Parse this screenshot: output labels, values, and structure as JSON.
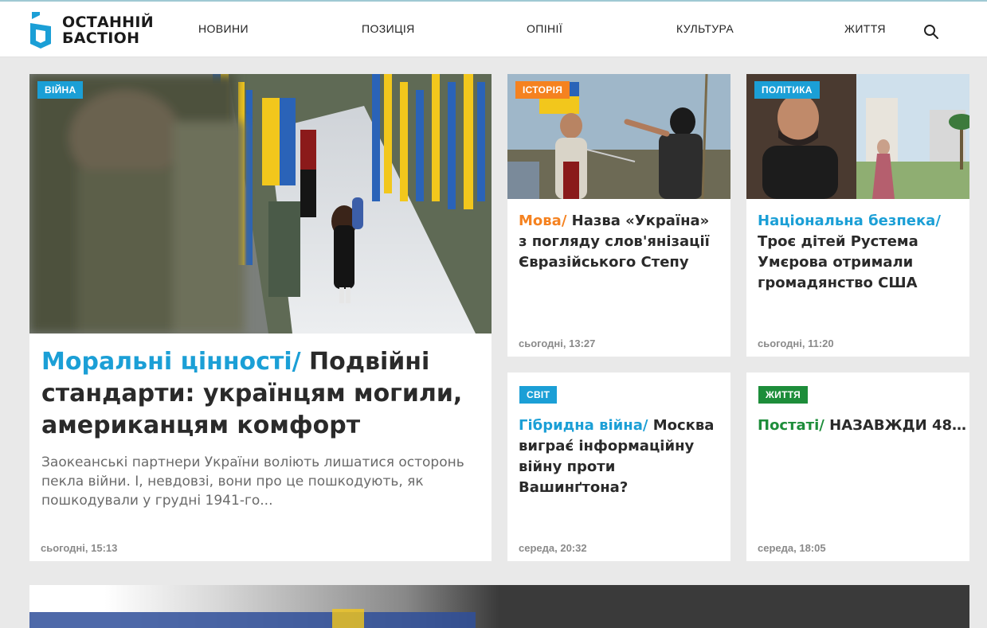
{
  "site": {
    "logo_line1": "ОСТАННІЙ",
    "logo_line2": "БАСТІОН"
  },
  "nav": [
    "НОВИНИ",
    "ПОЗИЦІЯ",
    "ОПІНІЇ",
    "КУЛЬТУРА",
    "ЖИТТЯ"
  ],
  "colors": {
    "accent_blue": "#1b9fd6",
    "accent_orange": "#f58220",
    "accent_green": "#1d8d3a"
  },
  "articles": [
    {
      "badge": "ВІЙНА",
      "rubric": "Моральні цінності/",
      "title": "Подвійні стандарти: українцям могили, американцям комфорт",
      "lead": "Заокеанські партнери України воліють лишатися осторонь пекла війни. І, невдовзі, вони про це пошкодують, як пошкодували у грудні 1941-го...",
      "time": "сьогодні, 15:13"
    },
    {
      "badge": "ІСТОРІЯ",
      "rubric": "Мова/",
      "title": "Назва «Україна» з погляду слов'янізації Євразійського Степу",
      "time": "сьогодні, 13:27"
    },
    {
      "badge": "ПОЛІТИКА",
      "rubric": "Національна безпека/",
      "title": "Троє дітей Рустема Умєрова отримали громадянство США",
      "time": "сьогодні, 11:20"
    },
    {
      "badge": "СВІТ",
      "rubric": "Гібридна війна/",
      "title": "Москва виграє́ інформаційну війну проти Вашинґтона?",
      "time": "середа, 20:32"
    },
    {
      "badge": "ЖИТТЯ",
      "rubric": "Постаті/",
      "title": "НАЗАВЖДИ 48…",
      "time": "середа, 18:05"
    }
  ]
}
